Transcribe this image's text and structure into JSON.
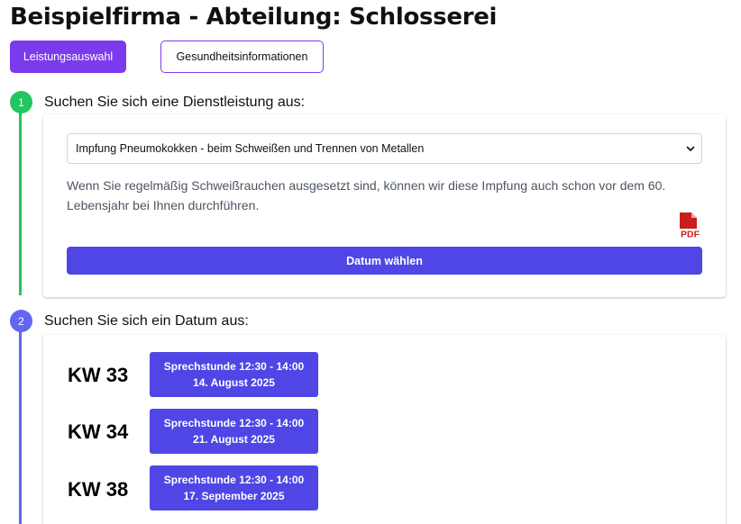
{
  "header": {
    "title": "Beispielfirma - Abteilung: Schlosserei"
  },
  "tabs": [
    {
      "label": "Leistungsauswahl",
      "active": true
    },
    {
      "label": "Gesundheitsinformationen",
      "active": false
    }
  ],
  "steps": [
    {
      "number": "1",
      "title": "Suchen Sie sich eine Dienstleistung aus:",
      "status_color": "#22c55e"
    },
    {
      "number": "2",
      "title": "Suchen Sie sich ein Datum aus:",
      "status_color": "#6366f1"
    }
  ],
  "service": {
    "selected": "Impfung Pneumokokken - beim Schweißen und Trennen von Metallen",
    "description": "Wenn Sie regelmäßig Schweißrauchen ausgesetzt sind, können wir diese Impfung auch schon vor dem 60. Lebensjahr bei Ihnen durchführen.",
    "pdf_icon": "pdf-file-icon",
    "pdf_label": "PDF",
    "button_label": "Datum wählen"
  },
  "slots": [
    {
      "week": "KW 33",
      "line1": "Sprechstunde 12:30 - 14:00",
      "line2": "14. August 2025"
    },
    {
      "week": "KW 34",
      "line1": "Sprechstunde 12:30 - 14:00",
      "line2": "21. August 2025"
    },
    {
      "week": "KW 38",
      "line1": "Sprechstunde 12:30 - 14:00",
      "line2": "17. September 2025"
    }
  ],
  "colors": {
    "accent_purple": "#7c3aed",
    "primary_indigo": "#4f46e5",
    "step_complete": "#22c55e",
    "step_current": "#6366f1",
    "pdf_red": "#c81e1e"
  }
}
